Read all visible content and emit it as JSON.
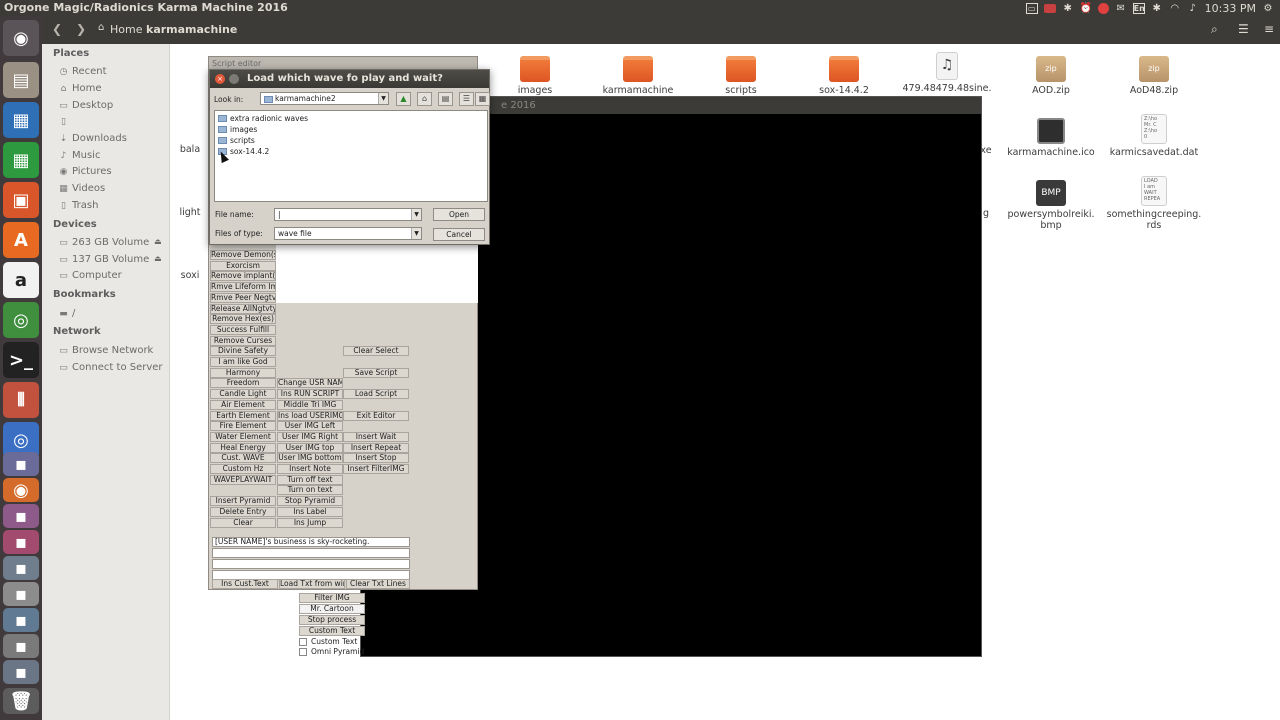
{
  "topbar": {
    "window_title": "Orgone Magic/Radionics Karma Machine 2016",
    "keyboard_layout": "En",
    "clock": "10:33 PM",
    "tray_icons": [
      "window-icon",
      "record-icon",
      "bluetooth-icon",
      "alarm-icon",
      "stop-icon",
      "mail-icon",
      "keyboard-icon",
      "bluetooth-icon",
      "wifi-icon",
      "volume-icon",
      "gear-icon"
    ]
  },
  "launcher": {
    "icons": [
      "ubuntu-dash-icon",
      "files-icon",
      "writer-icon",
      "calc-icon",
      "impress-icon",
      "software-center-icon",
      "amazon-icon",
      "chrome-icon",
      "terminal-icon",
      "settings-icon",
      "chromium-icon",
      "apps-icon",
      "firefox-icon",
      "app-icon",
      "app-icon",
      "app-icon",
      "app-icon",
      "app-icon",
      "app-icon",
      "app-icon",
      "trash-icon"
    ]
  },
  "nav": {
    "home_label": "Home",
    "current_label": "karmamachine"
  },
  "sidebar": {
    "places_header": "Places",
    "places": [
      "Recent",
      "Home",
      "Desktop",
      "",
      "Downloads",
      "Music",
      "Pictures",
      "Videos",
      "Trash"
    ],
    "devices_header": "Devices",
    "devices": [
      "263 GB Volume",
      "137 GB Volume",
      "Computer"
    ],
    "bookmarks_header": "Bookmarks",
    "bookmarks": [
      "/"
    ],
    "network_header": "Network",
    "network": [
      "Browse Network",
      "Connect to Server"
    ]
  },
  "files": {
    "row1": [
      "images",
      "karmamachine",
      "scripts",
      "sox-14.4.2",
      "479.48479.48sine.",
      "AOD.zip",
      "AoD48.zip"
    ],
    "row2": [
      "karmamachine.ico",
      "karmicsavedat.dat"
    ],
    "row3": [
      "powersymbolreiki.\nbmp",
      "somethingcreeping.\nrds"
    ],
    "partial_left": [
      "bala",
      "light",
      "soxi"
    ],
    "partial_mid": [
      "xe",
      "g"
    ],
    "zip_badge": "zip",
    "bmp_badge": "BMP",
    "wav_badge": "wav",
    "dat_preview": "Z:\\ho\nMr. C\nZ:\\ho\n0",
    "rds_preview": "LOAD\nI am\nWAIT\nREPEA"
  },
  "karma_window": {
    "title": "e 2016"
  },
  "editor": {
    "title": "Script editor",
    "col1": [
      "Remove Demon(s)",
      "Exorcism",
      "Remove implant(s)",
      "Rmve Lifeform Impl",
      "Rmve Peer Negtvty",
      "Release AllNgtvty",
      "Remove Hex(es)",
      "Success Fulfill",
      "Remove Curses",
      "Divine Safety",
      "I am like God",
      "Harmony",
      "Freedom",
      "Candle Light",
      "Air Element",
      "Earth Element",
      "Fire Element",
      "Water Element",
      "Heal Energy",
      "Cust. WAVE",
      "Custom Hz",
      "WAVEPLAYWAIT",
      "",
      "Insert Pyramid",
      "Delete Entry",
      "Clear"
    ],
    "col2": [
      "Change USR NAME",
      "Ins RUN SCRIPT",
      "Middle Tri IMG",
      "Ins load USERIMG",
      "User IMG Left",
      "User IMG Right",
      "User IMG top",
      "User IMG bottom",
      "Insert Note",
      "Turn off text",
      "Turn on text",
      "Stop Pyramid",
      "Ins Label",
      "Ins Jump"
    ],
    "col3_top": [
      "Clear Select",
      "Save Script",
      "Load Script",
      "Exit Editor"
    ],
    "col3": [
      "Insert Wait",
      "Insert Repeat",
      "Insert Stop",
      "Insert FilterIMG"
    ],
    "text_line": "[USER NAME]'s business is sky-rocketing.",
    "bottom_buttons": [
      "Ins Cust.Text",
      "Load Txt from win",
      "Clear Txt Lines"
    ]
  },
  "karma_controls": {
    "buttons": [
      "Filter IMG",
      "Mr. Cartoon",
      "Stop process",
      "Custom Text"
    ],
    "checkboxes": [
      "Custom Text",
      "Omni Pyramid"
    ]
  },
  "dialog": {
    "title": "Load which wave fo play and wait?",
    "look_in_label": "Look in:",
    "look_in_value": "karmamachine2",
    "folders": [
      "extra radionic waves",
      "images",
      "scripts",
      "sox-14.4.2"
    ],
    "file_name_label": "File name:",
    "file_name_value": "|",
    "files_of_type_label": "Files of type:",
    "files_of_type_value": "wave file",
    "open_label": "Open",
    "cancel_label": "Cancel"
  }
}
